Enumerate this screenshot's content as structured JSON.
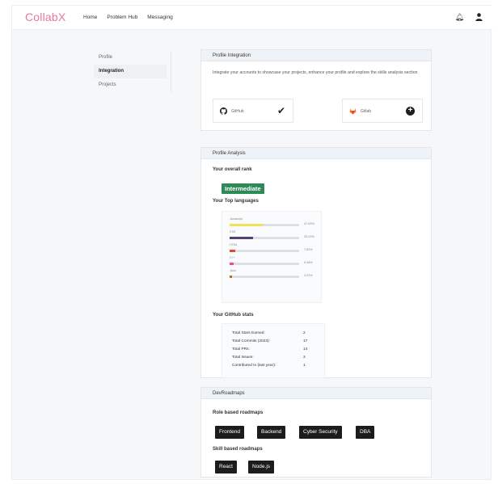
{
  "brand": "CollabX",
  "nav": {
    "links": [
      "Home",
      "Problem Hub",
      "Messaging"
    ],
    "icons": [
      "bell-icon",
      "user-icon"
    ]
  },
  "side_menu": {
    "items": [
      {
        "label": "Profile",
        "active": false
      },
      {
        "label": "Integration",
        "active": true
      },
      {
        "label": "Projects",
        "active": false
      }
    ]
  },
  "integration": {
    "title": "Profile Integration",
    "description": "Integrate your accounts to showcase your projects, enhance your profile and explore the skills analysis section",
    "accounts": [
      {
        "name": "GitHub",
        "icon": "github-icon",
        "status": "connected"
      },
      {
        "name": "Gitlab",
        "icon": "gitlab-icon",
        "status": "add"
      }
    ]
  },
  "analysis": {
    "title": "Profile Analysis",
    "rank_label": "Your overall rank",
    "rank": "Intermediate",
    "languages_label": "Your Top languages",
    "languages": [
      {
        "name": "Javascript",
        "percent": 47.69,
        "percent_label": "47.69%",
        "color": "#f1e05a"
      },
      {
        "name": "CSS",
        "percent": 33.2,
        "percent_label": "33.20%",
        "color": "#563d7c"
      },
      {
        "name": "HTML",
        "percent": 7.82,
        "percent_label": "7.82%",
        "color": "#e34c26"
      },
      {
        "name": "C++",
        "percent": 5.48,
        "percent_label": "5.48%",
        "color": "#f34b7d"
      },
      {
        "name": "Java",
        "percent": 3.22,
        "percent_label": "3.22%",
        "color": "#b07219"
      }
    ],
    "stats_label": "Your GitHub stats",
    "stats": [
      {
        "label": "Total Stars Earned:",
        "value": "2"
      },
      {
        "label": "Total Commits (2023):",
        "value": "17"
      },
      {
        "label": "Total PRs:",
        "value": "14"
      },
      {
        "label": "Total Issues:",
        "value": "3"
      },
      {
        "label": "Contributed to (last year):",
        "value": "1"
      }
    ]
  },
  "roadmaps": {
    "title": "DevRoadmaps",
    "role_label": "Role based roadmaps",
    "role": [
      "Frontend",
      "Backend",
      "Cyber Security",
      "DBA"
    ],
    "skill_label": "Skill based roadmaps",
    "skill": [
      "React",
      "Node.js"
    ]
  }
}
